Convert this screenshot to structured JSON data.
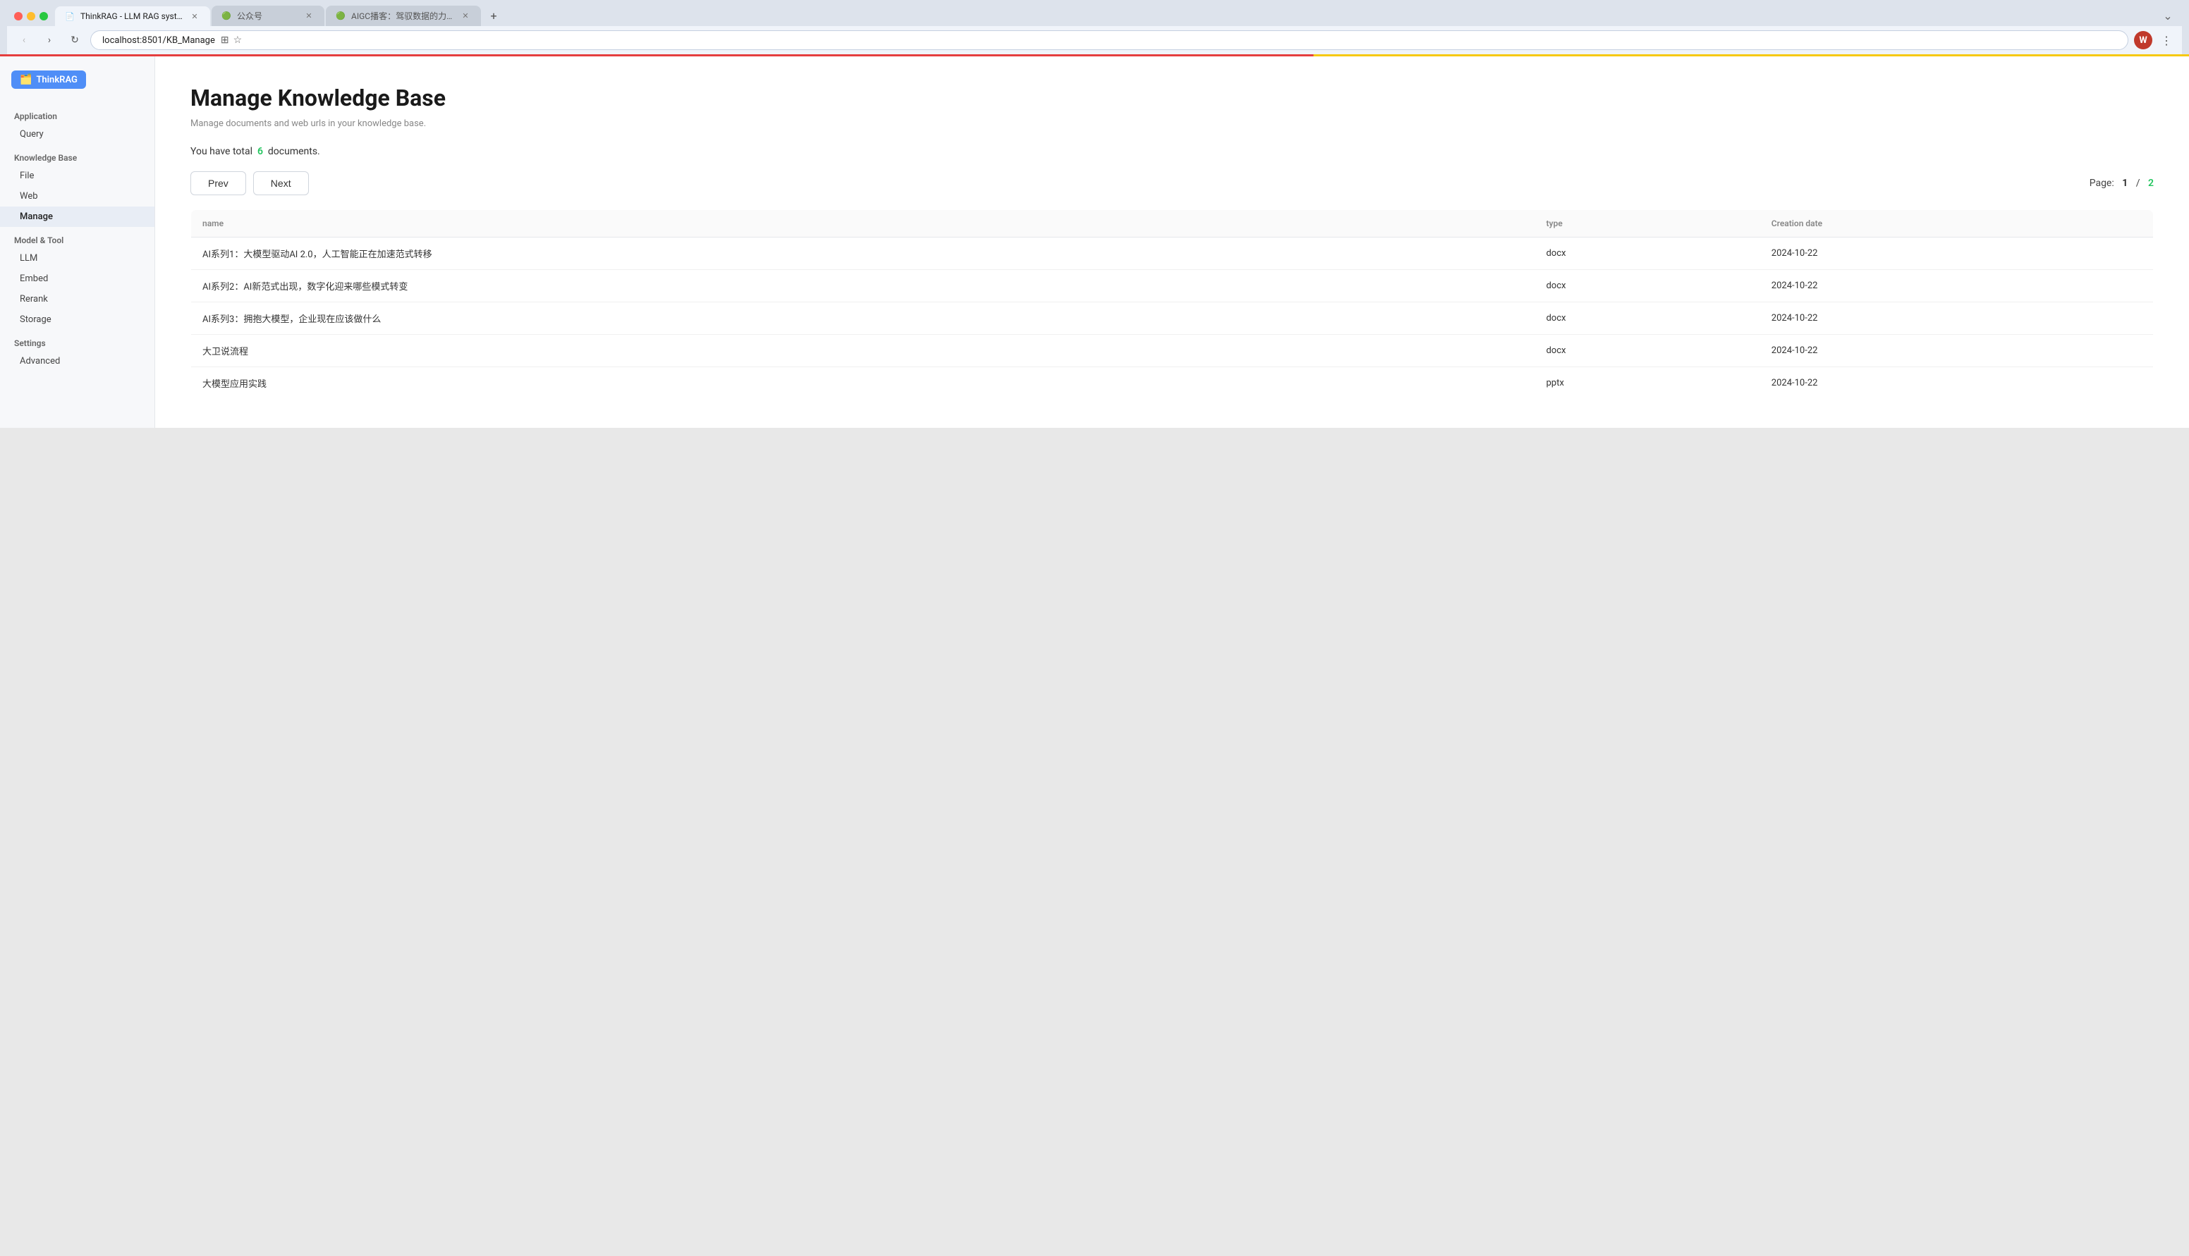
{
  "browser": {
    "url": "localhost:8501/KB_Manage",
    "tabs": [
      {
        "id": "tab1",
        "favicon": "📄",
        "title": "ThinkRAG - LLM RAG system...",
        "active": true
      },
      {
        "id": "tab2",
        "favicon": "🟢",
        "title": "公众号",
        "active": false
      },
      {
        "id": "tab3",
        "favicon": "🟢",
        "title": "AIGC播客：驾驭数据的力量",
        "active": false
      }
    ],
    "new_tab_label": "+"
  },
  "app": {
    "logo": "ThinkRAG",
    "logo_icon": "🗂️"
  },
  "sidebar": {
    "sections": [
      {
        "label": "Application",
        "items": [
          {
            "id": "query",
            "label": "Query",
            "active": false
          }
        ]
      },
      {
        "label": "Knowledge Base",
        "items": [
          {
            "id": "file",
            "label": "File",
            "active": false
          },
          {
            "id": "web",
            "label": "Web",
            "active": false
          },
          {
            "id": "manage",
            "label": "Manage",
            "active": true
          }
        ]
      },
      {
        "label": "Model & Tool",
        "items": [
          {
            "id": "llm",
            "label": "LLM",
            "active": false
          },
          {
            "id": "embed",
            "label": "Embed",
            "active": false
          },
          {
            "id": "rerank",
            "label": "Rerank",
            "active": false
          },
          {
            "id": "storage",
            "label": "Storage",
            "active": false
          }
        ]
      },
      {
        "label": "Settings",
        "items": [
          {
            "id": "advanced",
            "label": "Advanced",
            "active": false
          }
        ]
      }
    ]
  },
  "main": {
    "title": "Manage Knowledge Base",
    "subtitle": "Manage documents and web urls in your knowledge base.",
    "doc_count_prefix": "You have total",
    "doc_count_num": "6",
    "doc_count_suffix": "documents.",
    "prev_label": "Prev",
    "next_label": "Next",
    "page_label": "Page:",
    "current_page": "1",
    "separator": "/",
    "total_pages": "2",
    "table": {
      "columns": [
        "name",
        "type",
        "Creation date"
      ],
      "rows": [
        {
          "name": "AI系列1：大模型驱动AI 2.0，人工智能正在加速范式转移",
          "type": "docx",
          "date": "2024-10-22"
        },
        {
          "name": "AI系列2：AI新范式出现，数字化迎来哪些模式转变",
          "type": "docx",
          "date": "2024-10-22"
        },
        {
          "name": "AI系列3：拥抱大模型，企业现在应该做什么",
          "type": "docx",
          "date": "2024-10-22"
        },
        {
          "name": "大卫说流程",
          "type": "docx",
          "date": "2024-10-22"
        },
        {
          "name": "大模型应用实践",
          "type": "pptx",
          "date": "2024-10-22"
        }
      ]
    }
  }
}
